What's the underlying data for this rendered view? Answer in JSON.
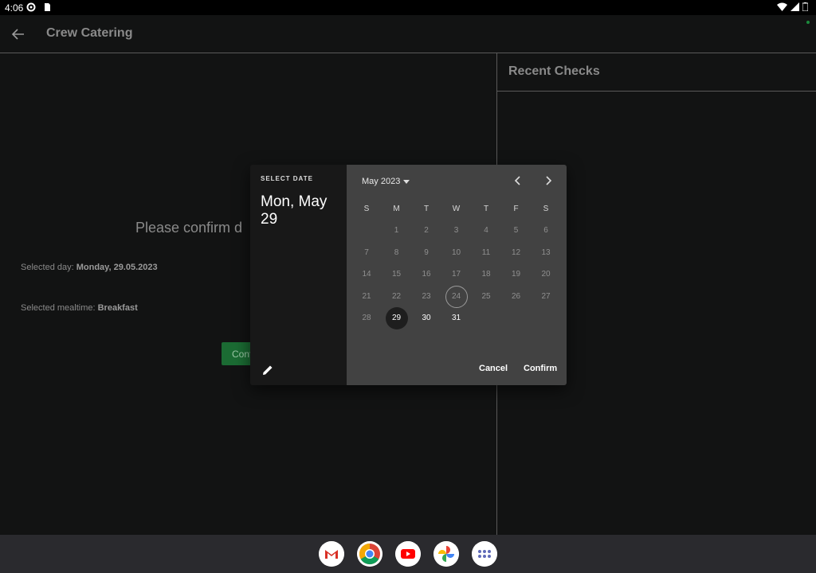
{
  "status": {
    "time": "4:06"
  },
  "app": {
    "title": "Crew Catering"
  },
  "main": {
    "heading": "Please confirm d",
    "selected_day_label": "Selected day: ",
    "selected_day_value": "Monday, 29.05.2023",
    "selected_meal_label": "Selected mealtime: ",
    "selected_meal_value": "Breakfast",
    "confirm_button": "Conf"
  },
  "panel": {
    "title": "Recent Checks"
  },
  "dialog": {
    "label": "SELECT DATE",
    "selected_date": "Mon, May 29",
    "month_label": "May 2023",
    "weekdays": [
      "S",
      "M",
      "T",
      "W",
      "T",
      "F",
      "S"
    ],
    "first_weekday_index": 1,
    "days": 31,
    "selected_day": 29,
    "today": 24,
    "active_days": [
      29,
      30,
      31
    ],
    "cancel": "Cancel",
    "confirm": "Confirm"
  },
  "dock": {
    "apps": [
      "gmail-icon",
      "chrome-icon",
      "youtube-icon",
      "photos-icon",
      "app-launcher-icon"
    ]
  }
}
